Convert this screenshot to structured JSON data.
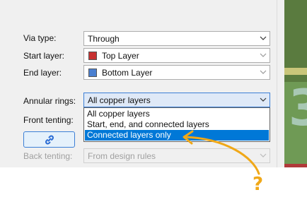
{
  "form": {
    "via_type": {
      "label": "Via type:",
      "value": "Through"
    },
    "start_layer": {
      "label": "Start layer:",
      "value": "Top Layer",
      "swatch": "#c83232"
    },
    "end_layer": {
      "label": "End layer:",
      "value": "Bottom Layer",
      "swatch": "#4a7fd0"
    },
    "annular_rings": {
      "label": "Annular rings:",
      "value": "All copper layers",
      "options": [
        "All copper layers",
        "Start, end, and connected layers",
        "Connected layers only"
      ],
      "highlighted_index": 2
    },
    "front_tenting": {
      "label": "Front tenting:"
    },
    "back_tenting": {
      "label": "Back tenting:",
      "value": "From design rules"
    }
  },
  "link_button": {
    "icon": "link-icon"
  },
  "annotation": {
    "text": "?",
    "color": "#f0a818",
    "icon": "curved-arrow"
  },
  "colors": {
    "selection": "#0078d7",
    "focus": "#3c7fd6",
    "panel": "#f0f0f0"
  }
}
